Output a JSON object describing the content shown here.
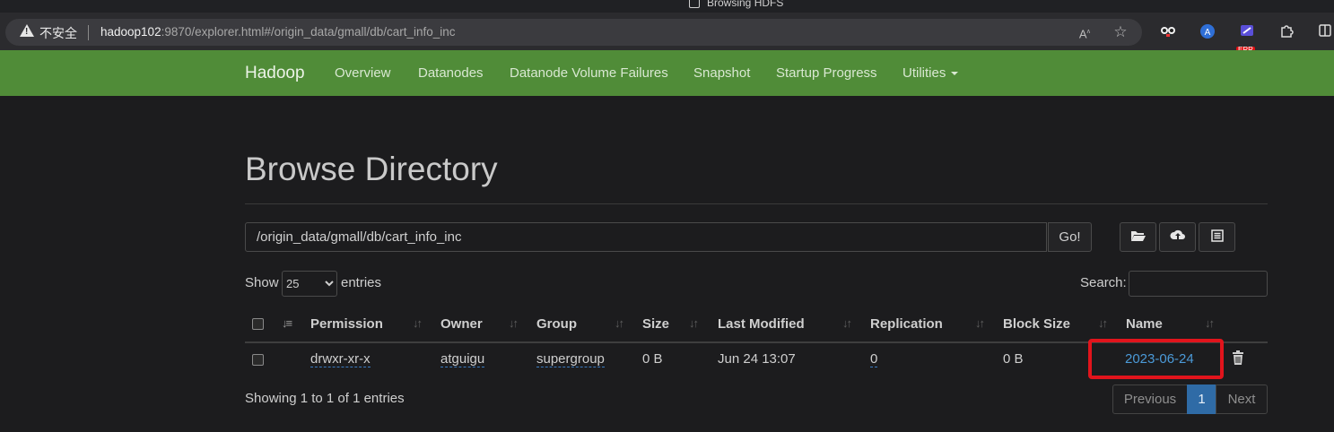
{
  "browser": {
    "tab_title": "Browsing HDFS",
    "security_label": "不安全",
    "url_host": "hadoop102",
    "url_rest": ":9870/explorer.html#/origin_data/gmall/db/cart_info_inc",
    "extension_badge": "ERR"
  },
  "navbar": {
    "brand": "Hadoop",
    "items": [
      "Overview",
      "Datanodes",
      "Datanode Volume Failures",
      "Snapshot",
      "Startup Progress",
      "Utilities"
    ]
  },
  "page": {
    "title": "Browse Directory",
    "path_value": "/origin_data/gmall/db/cart_info_inc",
    "go_label": "Go!"
  },
  "controls": {
    "show_label": "Show",
    "entries_value": "25",
    "entries_label": "entries",
    "search_label": "Search:"
  },
  "table": {
    "headers": [
      "Permission",
      "Owner",
      "Group",
      "Size",
      "Last Modified",
      "Replication",
      "Block Size",
      "Name"
    ],
    "rows": [
      {
        "permission": "drwxr-xr-x",
        "owner": "atguigu",
        "group": "supergroup",
        "size": "0 B",
        "modified": "Jun 24 13:07",
        "replication": "0",
        "block_size": "0 B",
        "name": "2023-06-24"
      }
    ],
    "info": "Showing 1 to 1 of 1 entries"
  },
  "pagination": {
    "previous": "Previous",
    "current": "1",
    "next": "Next"
  },
  "colors": {
    "navbar": "#508c38",
    "link": "#4b9ad8",
    "highlight_box": "#e1141c",
    "pager_active": "#2f6ba6"
  }
}
